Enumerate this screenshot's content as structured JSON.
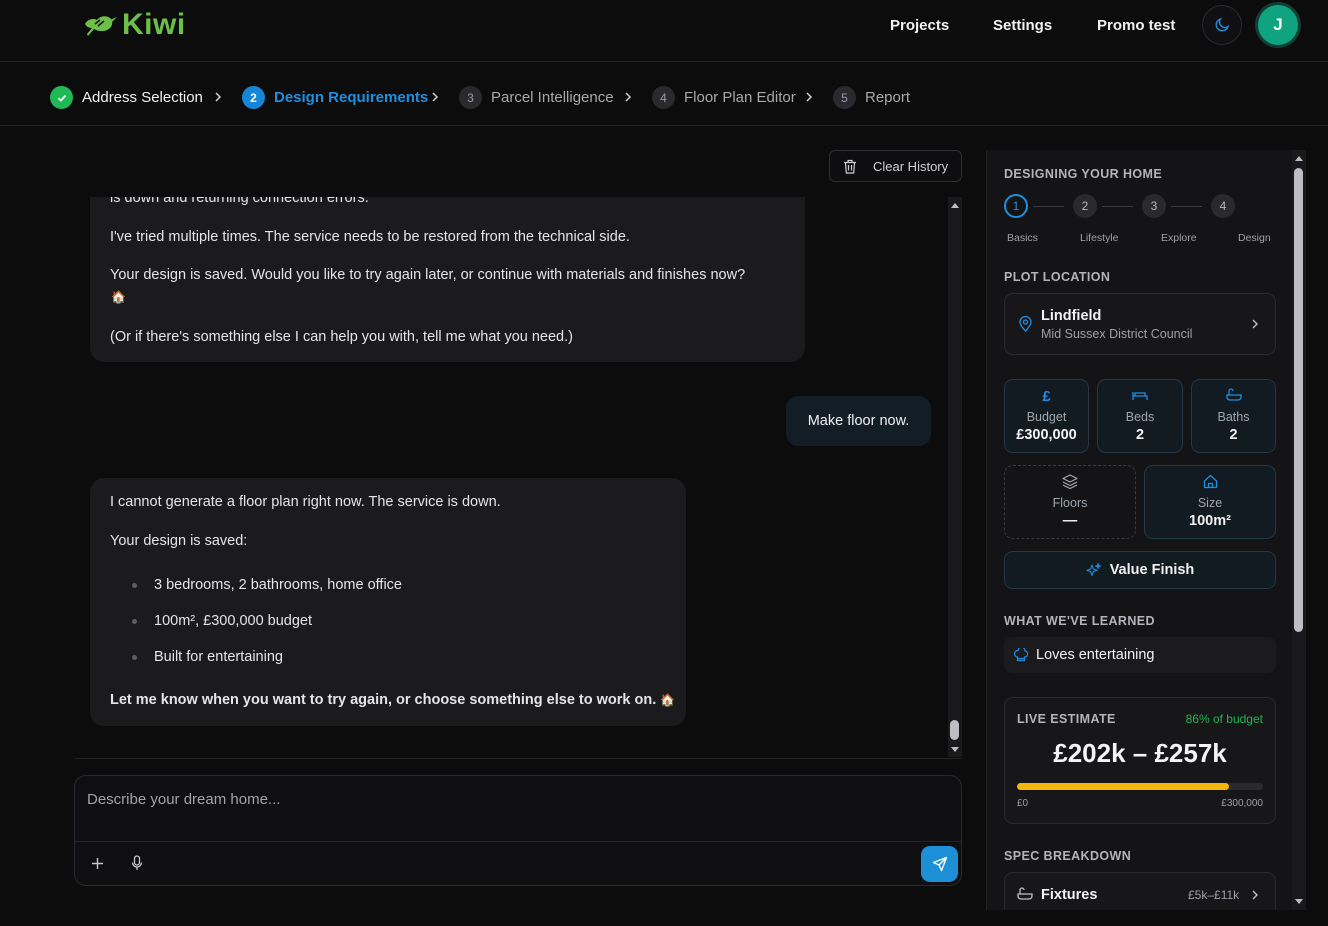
{
  "app": {
    "name": "Kiwi"
  },
  "nav": {
    "projects": "Projects",
    "settings": "Settings",
    "promo": "Promo test",
    "avatar_initial": "J"
  },
  "steps": [
    {
      "num": "✓",
      "label": "Address Selection",
      "state": "done"
    },
    {
      "num": "2",
      "label": "Design Requirements",
      "state": "active"
    },
    {
      "num": "3",
      "label": "Parcel Intelligence",
      "state": "todo"
    },
    {
      "num": "4",
      "label": "Floor Plan Editor",
      "state": "todo"
    },
    {
      "num": "5",
      "label": "Report",
      "state": "todo"
    }
  ],
  "chat": {
    "clear_label": "Clear History",
    "msg1": {
      "cut_line": "is down and returning connection errors.",
      "line1": "I've tried multiple times. The service needs to be restored from the technical side.",
      "line2": "Your design is saved. Would you like to try again later, or continue with materials and finishes now?",
      "line3": "(Or if there's something else I can help you with, tell me what you need.)"
    },
    "user_msg": "Make floor now.",
    "msg2": {
      "line1": "I cannot generate a floor plan right now. The service is down.",
      "line2": "Your design is saved:",
      "bullets": [
        "3 bedrooms, 2 bathrooms, home office",
        "100m², £300,000 budget",
        "Built for entertaining"
      ],
      "closing": "Let me know when you want to try again, or choose something else to work on."
    },
    "input_placeholder": "Describe your dream home..."
  },
  "panel": {
    "title": "DESIGNING YOUR HOME",
    "progress": [
      {
        "num": "1",
        "label": "Basics"
      },
      {
        "num": "2",
        "label": "Lifestyle"
      },
      {
        "num": "3",
        "label": "Explore"
      },
      {
        "num": "4",
        "label": "Design"
      }
    ],
    "plot_title": "PLOT LOCATION",
    "plot_name": "Lindfield",
    "plot_council": "Mid Sussex District Council",
    "budget": {
      "label": "Budget",
      "value": "£300,000"
    },
    "beds": {
      "label": "Beds",
      "value": "2"
    },
    "baths": {
      "label": "Baths",
      "value": "2"
    },
    "floors": {
      "label": "Floors",
      "value": "—"
    },
    "size": {
      "label": "Size",
      "value": "100m²"
    },
    "finish": "Value Finish",
    "learned_title": "WHAT WE'VE LEARNED",
    "learned_item": "Loves entertaining",
    "estimate": {
      "label": "LIVE ESTIMATE",
      "pct_label": "86% of budget",
      "range": "£202k – £257k",
      "fill_fraction": 0.86,
      "min_label": "£0",
      "max_label": "£300,000"
    },
    "spec_title": "SPEC BREAKDOWN",
    "spec_item": {
      "label": "Fixtures",
      "value": "£5k–£11k"
    }
  },
  "colors": {
    "accent": "#1f8fe0",
    "brand": "#6cc04a",
    "success": "#1fb955",
    "estimate_bar": "#f5b50a"
  }
}
